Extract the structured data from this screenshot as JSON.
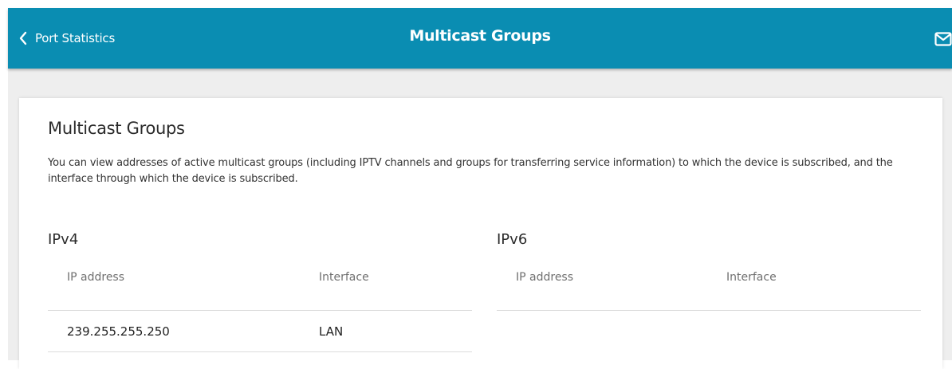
{
  "header": {
    "back_label": "Port Statistics",
    "title": "Multicast Groups",
    "background_color": "#0a8db2",
    "icons": {
      "back": "chevron-left-icon",
      "mail": "mail-icon"
    }
  },
  "main": {
    "title": "Multicast Groups",
    "description": "You can view addresses of active multicast groups (including IPTV channels and groups for transferring service information) to which the device is subscribed, and the interface through which the device is subscribed.",
    "ipv4": {
      "title": "IPv4",
      "columns": [
        "IP address",
        "Interface"
      ],
      "rows": [
        {
          "ip": "239.255.255.250",
          "interface": "LAN"
        }
      ]
    },
    "ipv6": {
      "title": "IPv6",
      "columns": [
        "IP address",
        "Interface"
      ],
      "rows": []
    }
  }
}
